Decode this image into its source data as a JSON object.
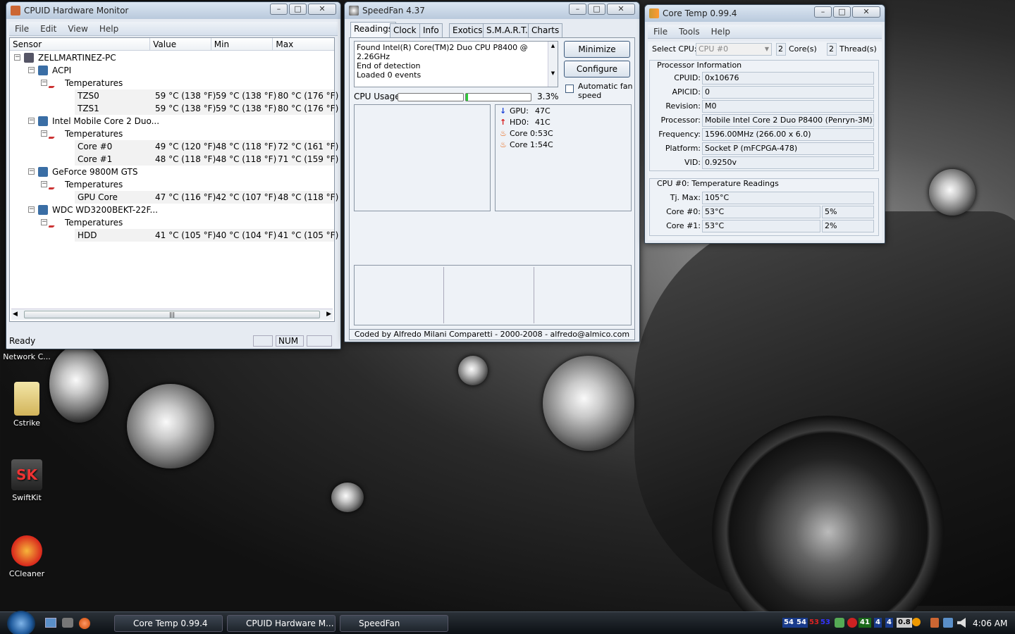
{
  "hwmonitor": {
    "title": "CPUID Hardware Monitor",
    "menu": [
      "File",
      "Edit",
      "View",
      "Help"
    ],
    "columns": [
      "Sensor",
      "Value",
      "Min",
      "Max"
    ],
    "rows": [
      {
        "label": "ZELLMARTINEZ-PC",
        "level": 0,
        "value": "",
        "min": "",
        "max": ""
      },
      {
        "label": "ACPI",
        "level": 1,
        "value": "",
        "min": "",
        "max": ""
      },
      {
        "label": "Temperatures",
        "level": 2,
        "value": "",
        "min": "",
        "max": ""
      },
      {
        "label": "TZS0",
        "level": 3,
        "value": "59 °C  (138 °F)",
        "min": "59 °C  (138 °F)",
        "max": "80 °C  (176 °F)"
      },
      {
        "label": "TZS1",
        "level": 3,
        "value": "59 °C  (138 °F)",
        "min": "59 °C  (138 °F)",
        "max": "80 °C  (176 °F)"
      },
      {
        "label": "Intel Mobile Core 2 Duo...",
        "level": 1,
        "value": "",
        "min": "",
        "max": ""
      },
      {
        "label": "Temperatures",
        "level": 2,
        "value": "",
        "min": "",
        "max": ""
      },
      {
        "label": "Core #0",
        "level": 3,
        "value": "49 °C  (120 °F)",
        "min": "48 °C  (118 °F)",
        "max": "72 °C  (161 °F)"
      },
      {
        "label": "Core #1",
        "level": 3,
        "value": "48 °C  (118 °F)",
        "min": "48 °C  (118 °F)",
        "max": "71 °C  (159 °F)"
      },
      {
        "label": "GeForce 9800M GTS",
        "level": 1,
        "value": "",
        "min": "",
        "max": ""
      },
      {
        "label": "Temperatures",
        "level": 2,
        "value": "",
        "min": "",
        "max": ""
      },
      {
        "label": "GPU Core",
        "level": 3,
        "value": "47 °C  (116 °F)",
        "min": "42 °C  (107 °F)",
        "max": "48 °C  (118 °F)"
      },
      {
        "label": "WDC WD3200BEKT-22F...",
        "level": 1,
        "value": "",
        "min": "",
        "max": ""
      },
      {
        "label": "Temperatures",
        "level": 2,
        "value": "",
        "min": "",
        "max": ""
      },
      {
        "label": "HDD",
        "level": 3,
        "value": "41 °C  (105 °F)",
        "min": "40 °C  (104 °F)",
        "max": "41 °C  (105 °F)"
      }
    ],
    "status": "Ready",
    "num": "NUM"
  },
  "speedfan": {
    "title": "SpeedFan 4.37",
    "tabs": [
      "Readings",
      "Clock",
      "Info",
      "Exotics",
      "S.M.A.R.T.",
      "Charts"
    ],
    "log": [
      "Found Intel(R) Core(TM)2 Duo CPU P8400 @ 2.26GHz",
      "End of detection",
      "Loaded 0 events"
    ],
    "minimize": "Minimize",
    "configure": "Configure",
    "auto_fan": "Automatic fan speed",
    "cpu_usage_label": "CPU Usage",
    "cpu_usage_value": "3.3%",
    "cpu_usage_fraction": 0.033,
    "temps": [
      {
        "name": "GPU:",
        "value": "47C",
        "icon": "arrow-down-icon",
        "color": "#1a3fd6"
      },
      {
        "name": "HD0:",
        "value": "41C",
        "icon": "arrow-up-icon",
        "color": "#d61a1a"
      },
      {
        "name": "Core 0:",
        "value": "53C",
        "icon": "flame-icon",
        "color": "#e85a00"
      },
      {
        "name": "Core 1:",
        "value": "54C",
        "icon": "flame-icon",
        "color": "#e85a00"
      }
    ],
    "footer": "Coded by Alfredo Milani Comparetti - 2000-2008 - alfredo@almico.com"
  },
  "coretemp": {
    "title": "Core Temp 0.99.4",
    "menu": [
      "File",
      "Tools",
      "Help"
    ],
    "select_cpu_label": "Select CPU:",
    "select_cpu_value": "CPU #0",
    "cores_count": "2",
    "cores_label": "Core(s)",
    "threads_count": "2",
    "threads_label": "Thread(s)",
    "proc_info_title": "Processor Information",
    "info": [
      {
        "label": "CPUID:",
        "value": "0x10676"
      },
      {
        "label": "APICID:",
        "value": "0"
      },
      {
        "label": "Revision:",
        "value": "M0"
      },
      {
        "label": "Processor:",
        "value": "Mobile Intel Core 2 Duo P8400 (Penryn-3M)"
      },
      {
        "label": "Frequency:",
        "value": "1596.00MHz (266.00 x 6.0)"
      },
      {
        "label": "Platform:",
        "value": "Socket P (mFCPGA-478)"
      },
      {
        "label": "VID:",
        "value": "0.9250v"
      }
    ],
    "temp_title": "CPU #0: Temperature Readings",
    "tjmax_label": "Tj. Max:",
    "tjmax_value": "105°C",
    "cores": [
      {
        "label": "Core #0:",
        "temp": "53°C",
        "load": "5%"
      },
      {
        "label": "Core #1:",
        "temp": "53°C",
        "load": "2%"
      }
    ]
  },
  "desktop": {
    "icons": [
      {
        "label": "Network C...",
        "name": "network-icon"
      },
      {
        "label": "Cstrike",
        "name": "folder-icon"
      },
      {
        "label": "SwiftKit",
        "name": "swiftkit-icon"
      },
      {
        "label": "CCleaner",
        "name": "ccleaner-icon"
      }
    ]
  },
  "taskbar": {
    "items": [
      "Core Temp 0.99.4",
      "CPUID Hardware M...",
      "SpeedFan"
    ],
    "tray_numbers": [
      "54",
      "54",
      "53",
      "53",
      "41",
      "4",
      "4",
      "0.8"
    ],
    "clock": "4:06 AM"
  }
}
